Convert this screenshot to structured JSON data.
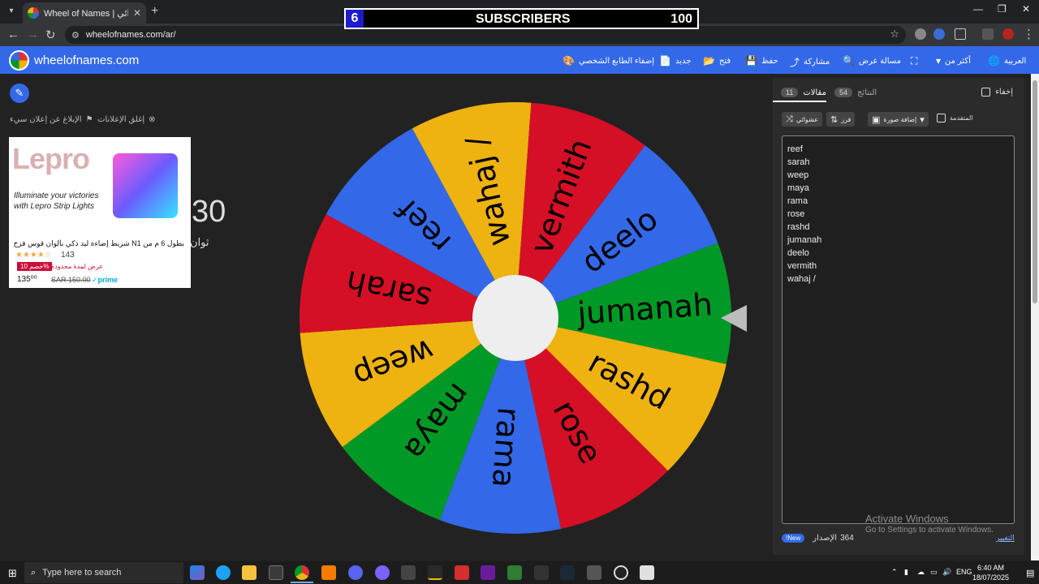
{
  "browser": {
    "tab_title": "Wheel of Names | اسم العشوائي",
    "tab_close": "✕",
    "new_tab": "+",
    "url": "wheelofnames.com/ar/",
    "window_controls": {
      "minimize": "—",
      "restore": "❐",
      "close": "✕"
    }
  },
  "overlay": {
    "count": "6",
    "label": "SUBSCRIBERS",
    "goal": "100"
  },
  "header": {
    "brand": "wheelofnames.com",
    "menu": [
      {
        "label": "إضفاء الطابع الشخصي",
        "icon": "palette-icon",
        "glyph": "🎨"
      },
      {
        "label": "جديد",
        "icon": "file-icon",
        "glyph": "📄"
      },
      {
        "label": "فتح",
        "icon": "folder-icon",
        "glyph": "📂"
      },
      {
        "label": "حفظ",
        "icon": "save-icon",
        "glyph": "💾"
      },
      {
        "label": "مشاركة",
        "icon": "share-icon",
        "glyph": "⤴"
      },
      {
        "label": "مسالة عرض",
        "icon": "search-icon",
        "glyph": "🔍"
      },
      {
        "label": "",
        "icon": "fullscreen-icon",
        "glyph": "⛶"
      },
      {
        "label": "أكثر من",
        "icon": "caret-down-icon",
        "glyph": "▾"
      },
      {
        "label": "العربية",
        "icon": "globe-icon",
        "glyph": "🌐"
      }
    ]
  },
  "page": {
    "report_ad": "الإبلاغ عن إعلان سيء",
    "close_ads": "إغلق الإعلانات",
    "bg_digits": "30",
    "bg_unit": "ثوان"
  },
  "ad": {
    "brand": "Lepro",
    "tagline": "Illuminate your victories with Lepro Strip Lights",
    "title": "بطول 6 م من N1 شريط إضاءة ليد ذكي بألوان قوس قزح",
    "stars": "★★★★☆",
    "reviews": "143",
    "badge": "خصم 10%",
    "deal": "عرض لمدة محدودة",
    "price": "135⁰⁰",
    "old_price": "SAR 150.00",
    "prime": "✓prime"
  },
  "wheel": {
    "segments": [
      {
        "label": "jumanah",
        "color": "#009925"
      },
      {
        "label": "rashd",
        "color": "#eeb211"
      },
      {
        "label": "rose",
        "color": "#d50f25"
      },
      {
        "label": "rama",
        "color": "#3369e8"
      },
      {
        "label": "maya",
        "color": "#009925"
      },
      {
        "label": "weep",
        "color": "#eeb211"
      },
      {
        "label": "sarah",
        "color": "#d50f25"
      },
      {
        "label": "reef",
        "color": "#3369e8"
      },
      {
        "label": "wahaj /",
        "color": "#eeb211"
      },
      {
        "label": "vermith",
        "color": "#d50f25"
      },
      {
        "label": "deelo",
        "color": "#3369e8"
      }
    ]
  },
  "panel": {
    "entries_tab": "مقالات",
    "entries_count": "11",
    "results_tab": "النتائج",
    "results_count": "54",
    "hide_label": "إخفاء",
    "shuffle_label": "عشوائي",
    "sort_label": "فرز",
    "add_image_label": "إضافة صورة",
    "advanced_label": "المتقدمة",
    "entries": [
      "reef",
      "sarah",
      "weep",
      "maya",
      "rama",
      "rose",
      "rashd",
      "jumanah",
      "deelo",
      "vermith",
      "wahaj /"
    ],
    "activate_title": "Activate Windows",
    "activate_sub": "Go to Settings to activate Windows.",
    "version_label": "الإصدار",
    "version_number": "364",
    "new_badge": "New!",
    "changelog": "التغيير"
  },
  "taskbar": {
    "search_placeholder": "Type here to search",
    "lang": "ENG",
    "time": "6:40 AM",
    "date": "18/07/2025"
  },
  "colors": {
    "brand_blue": "#3369e8",
    "panel_bg": "#2b2b2b",
    "page_bg": "#222222"
  }
}
